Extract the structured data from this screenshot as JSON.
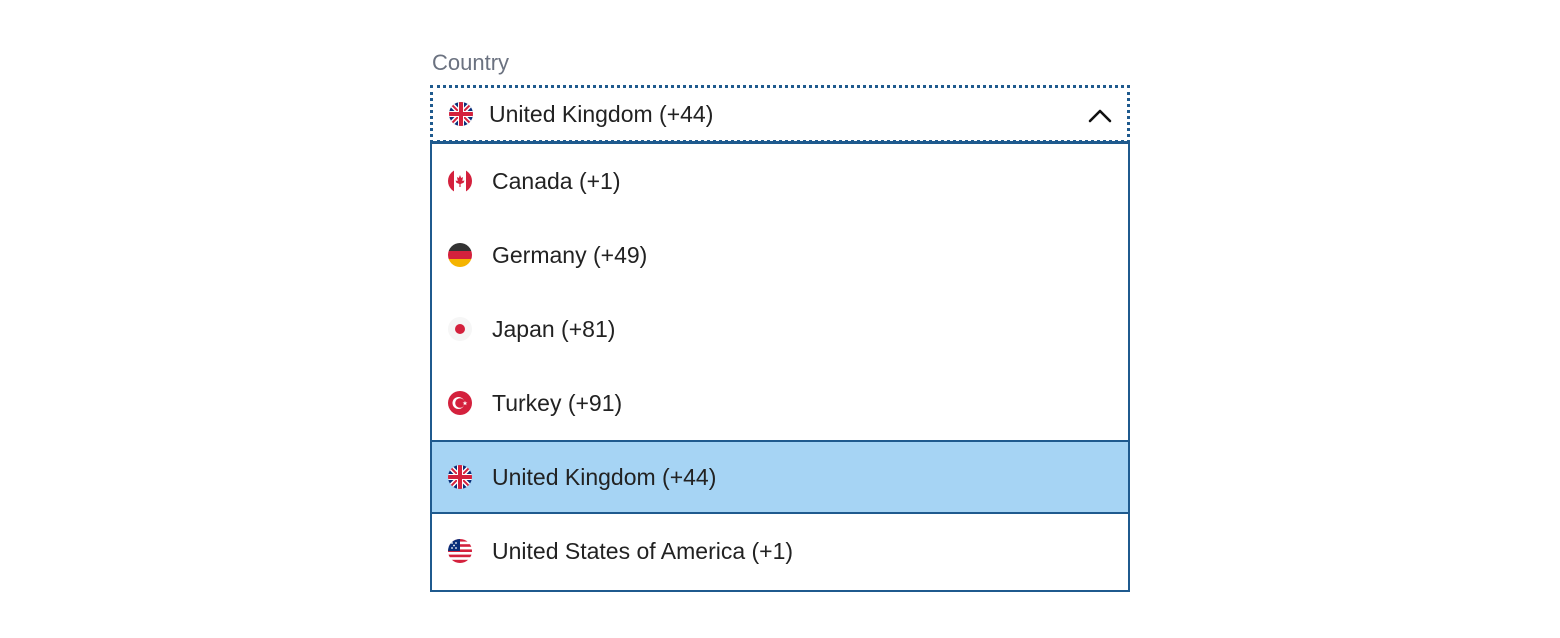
{
  "field": {
    "label": "Country",
    "selected_value": "United Kingdom (+44)",
    "selected_flag": "uk-flag-icon",
    "expanded": true
  },
  "options": [
    {
      "label": "Canada (+1)",
      "icon": "canada-flag-icon",
      "selected": false
    },
    {
      "label": "Germany (+49)",
      "icon": "germany-flag-icon",
      "selected": false
    },
    {
      "label": "Japan (+81)",
      "icon": "japan-flag-icon",
      "selected": false
    },
    {
      "label": "Turkey (+91)",
      "icon": "turkey-flag-icon",
      "selected": false
    },
    {
      "label": "United Kingdom (+44)",
      "icon": "uk-flag-icon",
      "selected": true
    },
    {
      "label": "United States of America (+1)",
      "icon": "usa-flag-icon",
      "selected": false
    }
  ],
  "colors": {
    "border": "#1f5a8e",
    "selected_bg": "#a6d4f4",
    "label": "#6b7280",
    "text": "#222222"
  }
}
